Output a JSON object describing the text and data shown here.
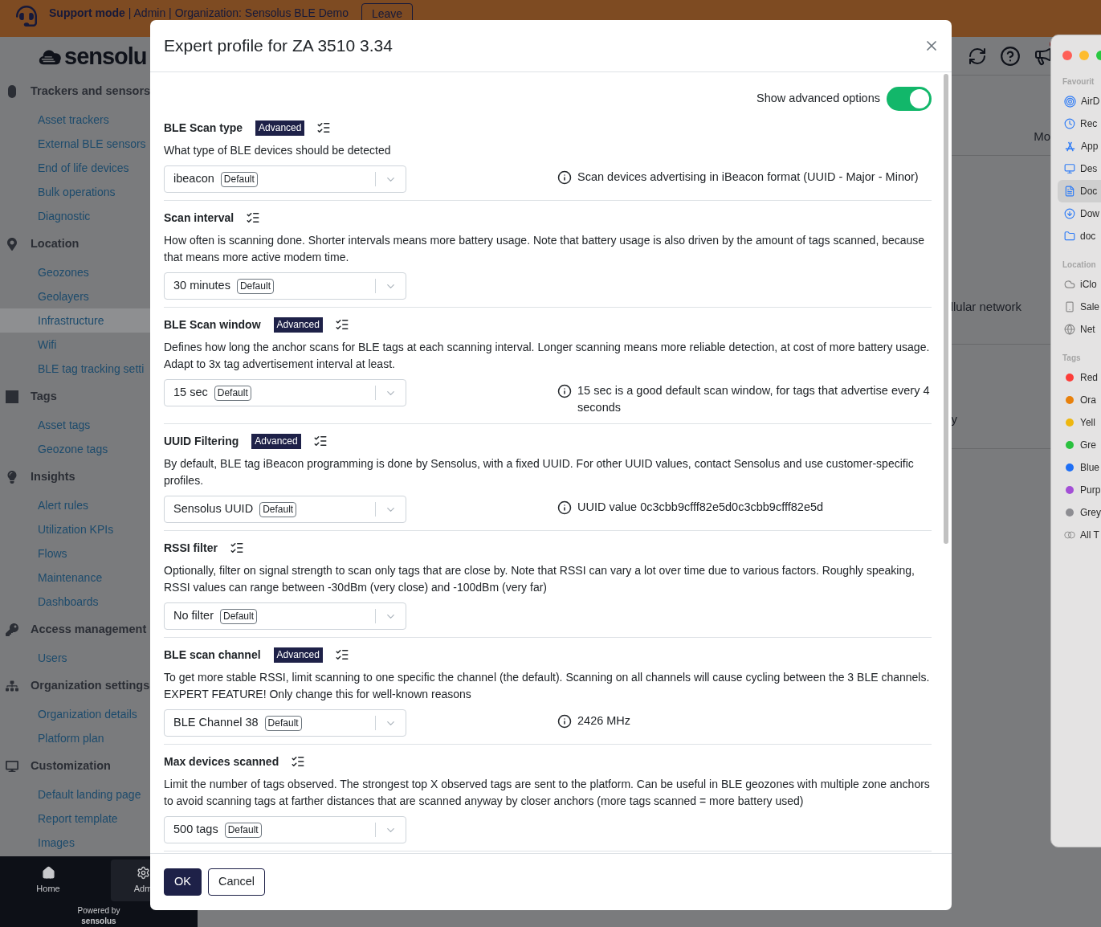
{
  "support_bar": {
    "mode": "Support mode",
    "context": " | Admin | Organization: Sensolus BLE Demo",
    "leave_button": "Leave"
  },
  "logo": {
    "text": "sensolu"
  },
  "sidebar": [
    {
      "label": "Trackers and sensors",
      "items": [
        {
          "label": "Asset trackers",
          "selected": false
        },
        {
          "label": "External BLE sensors",
          "selected": false
        },
        {
          "label": "End of life devices",
          "selected": false
        },
        {
          "label": "Bulk operations",
          "selected": false
        },
        {
          "label": "Diagnostic",
          "selected": false
        }
      ]
    },
    {
      "label": "Location",
      "items": [
        {
          "label": "Geozones",
          "selected": false
        },
        {
          "label": "Geolayers",
          "selected": false
        },
        {
          "label": "Infrastructure",
          "selected": true
        },
        {
          "label": "Wifi",
          "selected": false
        },
        {
          "label": "BLE tag tracking setti",
          "selected": false
        }
      ]
    },
    {
      "label": "Tags",
      "items": [
        {
          "label": "Asset tags",
          "selected": false
        },
        {
          "label": "Geozone tags",
          "selected": false
        }
      ]
    },
    {
      "label": "Insights",
      "items": [
        {
          "label": "Alert rules",
          "selected": false
        },
        {
          "label": "Utilization KPIs",
          "selected": false
        },
        {
          "label": "Flows",
          "selected": false
        },
        {
          "label": "Maintenance",
          "selected": false
        },
        {
          "label": "Dashboards",
          "selected": false
        }
      ]
    },
    {
      "label": "Access management",
      "items": [
        {
          "label": "Users",
          "selected": false
        }
      ]
    },
    {
      "label": "Organization settings",
      "items": [
        {
          "label": "Organization details",
          "selected": false
        },
        {
          "label": "Platform plan",
          "selected": false
        }
      ]
    },
    {
      "label": "Customization",
      "items": [
        {
          "label": "Default landing page",
          "selected": false
        },
        {
          "label": "Report template",
          "selected": false
        },
        {
          "label": "Images",
          "selected": false
        }
      ]
    }
  ],
  "bottom_nav": [
    {
      "label": "Home",
      "selected": false
    },
    {
      "label": "Adm",
      "selected": true
    }
  ],
  "powered_by": {
    "label": "Powered by",
    "logo": "sensolus"
  },
  "background_rows": [
    {
      "text": "Mo"
    },
    {
      "text": "llular network"
    },
    {
      "text": "y"
    }
  ],
  "modal": {
    "title": "Expert profile for ZA 3510 3.34",
    "advanced_toggle": {
      "label": "Show advanced options",
      "on": true
    },
    "sections": [
      {
        "title": "BLE Scan type",
        "badge": "Advanced",
        "description": "What type of BLE devices should be detected",
        "value": "ibeacon",
        "tag": "Default",
        "info": "Scan devices advertising in iBeacon format (UUID - Major - Minor)"
      },
      {
        "title": "Scan interval",
        "description": "How often is scanning done. Shorter intervals means more battery usage. Note that battery usage is also driven by the amount of tags scanned, because that means more active modem time.",
        "value": "30 minutes",
        "tag": "Default"
      },
      {
        "title": "BLE Scan window",
        "badge": "Advanced",
        "description": "Defines how long the anchor scans for BLE tags at each scanning interval. Longer scanning means more reliable detection, at cost of more battery usage. Adapt to 3x tag advertisement interval at least.",
        "value": "15 sec",
        "tag": "Default",
        "info": "15 sec is a good default scan window, for tags that advertise every 4 seconds"
      },
      {
        "title": "UUID Filtering",
        "badge": "Advanced",
        "description": "By default, BLE tag iBeacon programming is done by Sensolus, with a fixed UUID. For other UUID values, contact Sensolus and use customer-specific profiles.",
        "value": "Sensolus UUID",
        "tag": "Default",
        "info": "UUID value 0c3cbb9cfff82e5d0c3cbb9cfff82e5d"
      },
      {
        "title": "RSSI filter",
        "description": "Optionally, filter on signal strength to scan only tags that are close by. Note that RSSI can vary a lot over time due to various factors. Roughly speaking, RSSI values can range between -30dBm (very close) and -100dBm (very far)",
        "value": "No filter",
        "tag": "Default"
      },
      {
        "title": "BLE scan channel",
        "badge": "Advanced",
        "description": "To get more stable RSSI, limit scanning to one specific the channel (the default). Scanning on all channels will cause cycling between the 3 BLE channels. EXPERT FEATURE! Only change this for well-known reasons",
        "value": "BLE Channel 38",
        "tag": "Default",
        "info": "2426 MHz"
      },
      {
        "title": "Max devices scanned",
        "description": "Limit the number of tags observed. The strongest top X observed tags are sent to the platform. Can be useful in BLE geozones with multiple zone anchors to avoid scanning tags at farther distances that are scanned anyway by closer anchors (more tags scanned = more battery used)",
        "value": "500 tags",
        "tag": "Default"
      }
    ],
    "buttons": [
      {
        "label": "OK",
        "kind": "primary"
      },
      {
        "label": "Cancel",
        "kind": "secondary"
      }
    ]
  },
  "finder": {
    "sections": [
      {
        "label": "Favourit",
        "items": [
          {
            "label": "AirD",
            "selected": false
          },
          {
            "label": "Rec",
            "selected": false
          },
          {
            "label": "App",
            "selected": false
          },
          {
            "label": "Des",
            "selected": false
          },
          {
            "label": "Doc",
            "selected": true
          },
          {
            "label": "Dow",
            "selected": false
          },
          {
            "label": "doc",
            "selected": false
          }
        ]
      },
      {
        "label": "Location",
        "items": [
          {
            "label": "iClo",
            "selected": false
          },
          {
            "label": "Sale",
            "selected": false
          },
          {
            "label": "Net",
            "selected": false
          }
        ]
      },
      {
        "label": "Tags",
        "items": [
          {
            "label": "Red",
            "color": "#fc3d39",
            "selected": false
          },
          {
            "label": "Ora",
            "color": "#e8810c",
            "selected": false
          },
          {
            "label": "Yell",
            "color": "#eeb70f",
            "selected": false
          },
          {
            "label": "Gre",
            "color": "#2ac13f",
            "selected": false
          },
          {
            "label": "Blue",
            "color": "#1f6ff5",
            "selected": false
          },
          {
            "label": "Purp",
            "color": "#a34fd6",
            "selected": false
          },
          {
            "label": "Grey",
            "color": "#8d8d92",
            "selected": false
          },
          {
            "label": "All T",
            "selected": false
          }
        ]
      }
    ]
  }
}
